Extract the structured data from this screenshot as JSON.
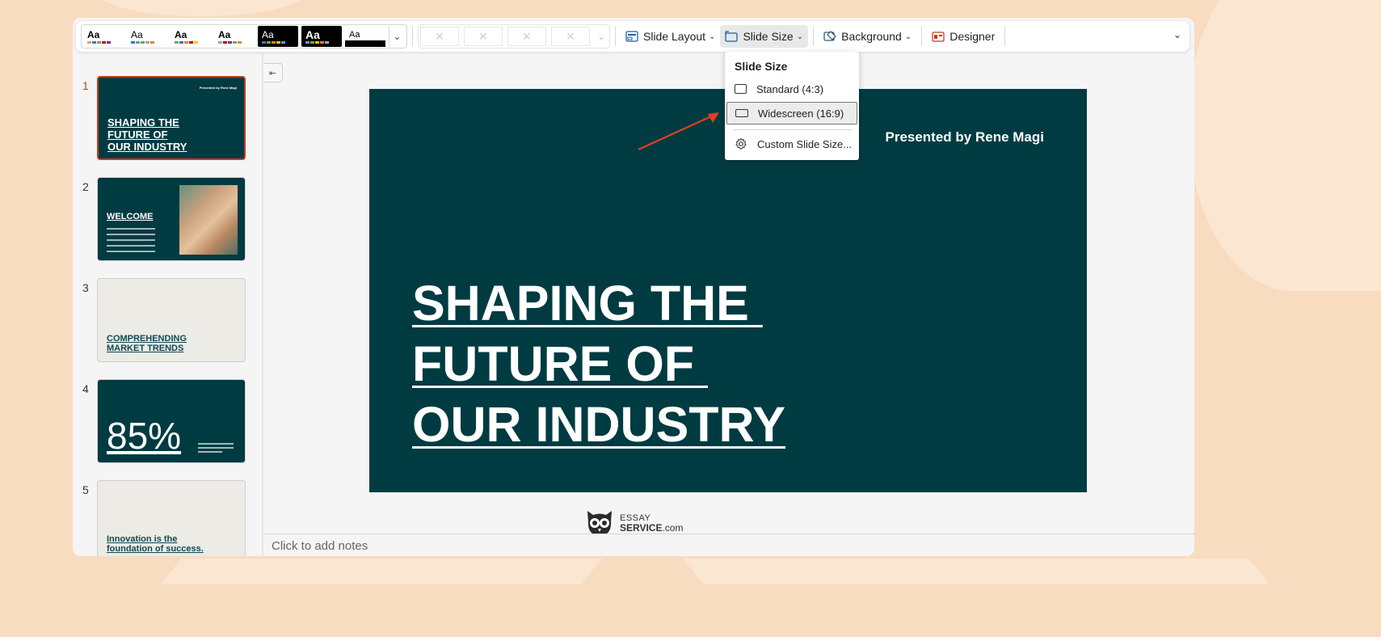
{
  "ribbon": {
    "themes": [
      {
        "label": "Aa",
        "style": "light",
        "accent": "#e8a33d"
      },
      {
        "label": "Aa",
        "style": "light",
        "accent": "#4472c4"
      },
      {
        "label": "Aa",
        "style": "light",
        "accent": "#70ad47"
      },
      {
        "label": "Aa",
        "style": "light",
        "accent": "#a5a5a5"
      },
      {
        "label": "Aa",
        "style": "dark",
        "accent": "#000000"
      },
      {
        "label": "Aa",
        "style": "dark",
        "accent": "#000000"
      },
      {
        "label": "Aa",
        "style": "mixed",
        "accent": "#000000"
      }
    ],
    "slide_layout_label": "Slide Layout",
    "slide_size_label": "Slide Size",
    "background_label": "Background",
    "designer_label": "Designer"
  },
  "dropdown": {
    "header": "Slide Size",
    "items": [
      "Standard (4:3)",
      "Widescreen (16:9)",
      "Custom Slide Size..."
    ],
    "selected_index": 1
  },
  "thumbnails": [
    {
      "number": "1",
      "presented": "Presented by Rene Magi",
      "lines": [
        "SHAPING THE",
        "FUTURE OF",
        "OUR INDUSTRY"
      ]
    },
    {
      "number": "2",
      "title": "WELCOME"
    },
    {
      "number": "3",
      "lines": [
        "COMPREHENDING",
        "MARKET TRENDS"
      ]
    },
    {
      "number": "4",
      "big": "85%"
    },
    {
      "number": "5",
      "lines": [
        "Innovation is the",
        "foundation of success."
      ]
    }
  ],
  "slide": {
    "presenter": "Presented by Rene Magi",
    "title_lines": [
      "SHAPING THE ",
      "FUTURE OF ",
      "OUR INDUSTRY"
    ]
  },
  "notes": {
    "placeholder": "Click to add notes"
  },
  "watermark": {
    "line1": "ESSAY",
    "line2_bold": "SERVICE",
    "line2_rest": ".com"
  },
  "colors": {
    "slide_bg": "#003b42",
    "selection": "#c43e1c",
    "arrow": "#e0401f",
    "page_bg": "#f8dcc0"
  }
}
